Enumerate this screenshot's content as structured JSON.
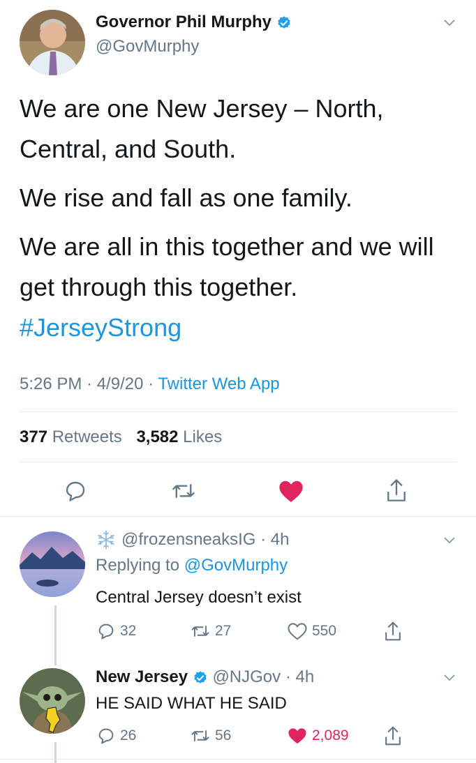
{
  "main_tweet": {
    "display_name": "Governor Phil Murphy",
    "handle": "@GovMurphy",
    "lines": [
      "We are one New Jersey – North,",
      "Central, and South.",
      "We rise and fall as one family.",
      "We are all in this together and we will",
      "get through this together."
    ],
    "hashtag": "#JerseyStrong",
    "time": "5:26 PM · 4/9/20 · ",
    "source": "Twitter Web App",
    "retweets_count": "377",
    "retweets_label": " Retweets",
    "likes_count": "3,582",
    "likes_label": " Likes"
  },
  "replies": [
    {
      "handle_time": "@frozensneaksIG · 4h",
      "replying_prefix": "Replying to ",
      "replying_handle": "@GovMurphy",
      "text": "Central Jersey doesn’t exist",
      "replies": "32",
      "retweets": "27",
      "likes": "550",
      "liked": false
    },
    {
      "display_name": "New Jersey",
      "handle_time": "@NJGov · 4h",
      "text": "HE SAID WHAT HE SAID",
      "replies": "26",
      "retweets": "56",
      "likes": "2,089",
      "liked": true
    }
  ],
  "colors": {
    "accent": "#1b95e0",
    "like": "#e0245e",
    "secondary_text": "#657786",
    "divider": "#e1e8ed"
  },
  "icons": [
    "verified-badge-icon",
    "chevron-down-icon",
    "reply-icon",
    "retweet-icon",
    "heart-icon",
    "share-icon",
    "snowflake-icon"
  ]
}
